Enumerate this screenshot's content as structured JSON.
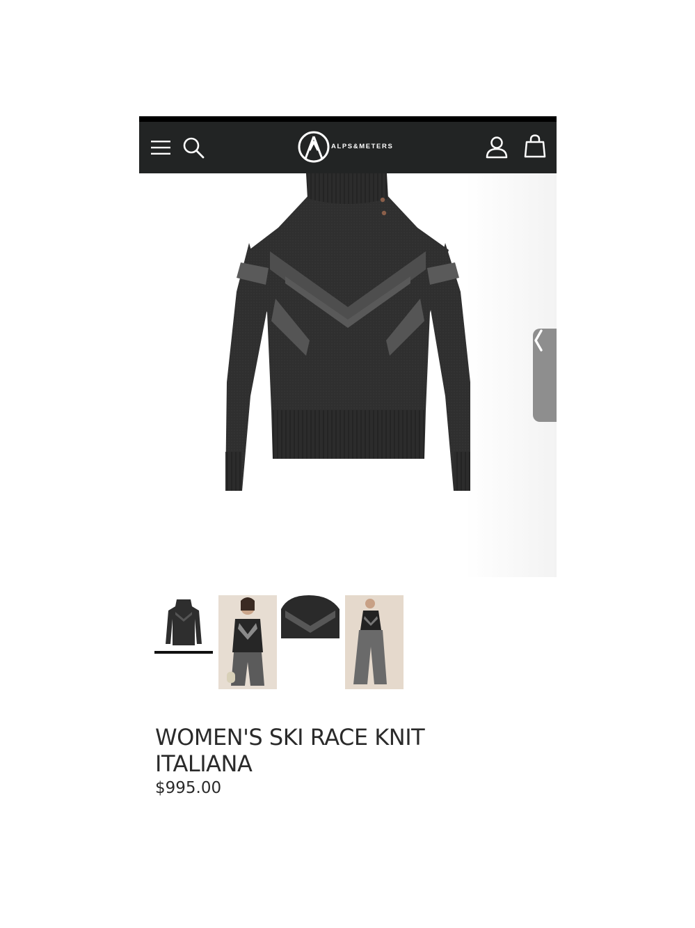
{
  "header": {
    "brand_name": "ALPS&METERS",
    "icons": [
      "menu-icon",
      "search-icon",
      "account-icon",
      "shopping-bag-icon"
    ]
  },
  "product": {
    "title": "WOMEN'S SKI RACE KNIT ITALIANA",
    "price": "$995.00",
    "selected_thumbnail_index": 0,
    "thumbnail_count": 4
  },
  "drawer_tab": {
    "icon": "chevron-left-icon"
  },
  "colors": {
    "header_bg": "#222424",
    "sweater_dark": "#2e2e2e",
    "sweater_accent": "#5c5c5c",
    "drawer_tab": "#8e8e8e"
  }
}
